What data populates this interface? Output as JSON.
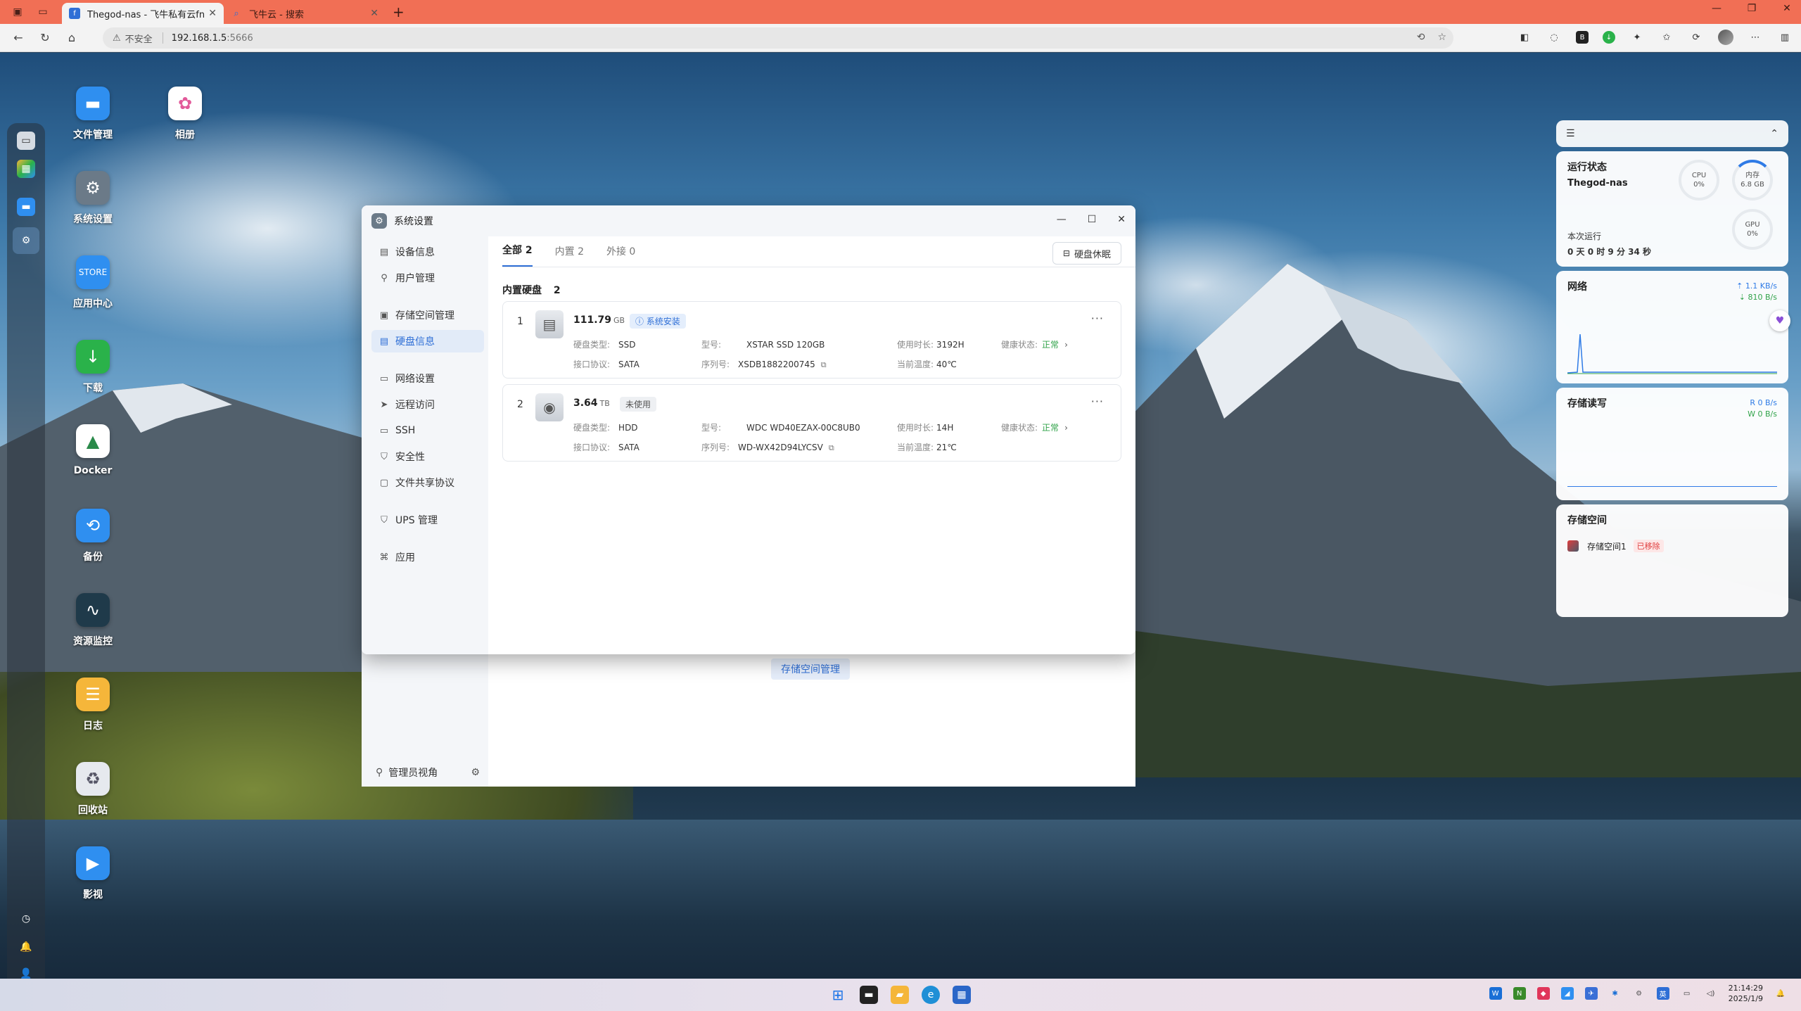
{
  "browser": {
    "tabs": [
      {
        "title": "Thegod-nas - 飞牛私有云fnOS",
        "active": true
      },
      {
        "title": "飞牛云 - 搜索",
        "active": false
      }
    ],
    "address": {
      "insecure_label": "不安全",
      "host": "192.168.1.5",
      "port": ":5666"
    }
  },
  "desktop": {
    "icons": [
      {
        "label": "文件管理",
        "icon": "folder-icon",
        "color": "#2f8ff0"
      },
      {
        "label": "相册",
        "icon": "photos-icon",
        "color": "#ffffff"
      },
      {
        "label": "系统设置",
        "icon": "gear-icon",
        "color": "#6b7a88"
      },
      {
        "label": "应用中心",
        "icon": "store-icon",
        "color": "#2f8ff0"
      },
      {
        "label": "下载",
        "icon": "download-icon",
        "color": "#2ab24a"
      },
      {
        "label": "Docker",
        "icon": "docker-icon",
        "color": "#ffffff"
      },
      {
        "label": "备份",
        "icon": "backup-icon",
        "color": "#2f8ff0"
      },
      {
        "label": "资源监控",
        "icon": "monitor-icon",
        "color": "#1f3a4a"
      },
      {
        "label": "日志",
        "icon": "log-icon",
        "color": "#f5b63a"
      },
      {
        "label": "回收站",
        "icon": "recycle-icon",
        "color": "#e6e9ee"
      },
      {
        "label": "影视",
        "icon": "video-icon",
        "color": "#2f8ff0"
      }
    ]
  },
  "widgets": {
    "status": {
      "title": "运行状态",
      "host": "Thegod-nas",
      "uptime_label": "本次运行",
      "uptime": "0 天 0 时 9 分 34 秒",
      "cpu": {
        "label": "CPU",
        "value": "0%"
      },
      "mem": {
        "label": "内存",
        "value": "6.8 GB"
      },
      "gpu": {
        "label": "GPU",
        "value": "0%"
      }
    },
    "network": {
      "title": "网络",
      "up": "1.1 KB/s",
      "down": "810 B/s"
    },
    "io": {
      "title": "存储读写",
      "read": "R  0 B/s",
      "write": "W  0 B/s"
    },
    "storage": {
      "title": "存储空间",
      "item": "存储空间1",
      "status": "已移除"
    }
  },
  "window": {
    "title": "系统设置",
    "nav": [
      {
        "label": "设备信息",
        "icon": "device-icon"
      },
      {
        "label": "用户管理",
        "icon": "user-icon"
      },
      {
        "label": "存储空间管理",
        "icon": "storage-icon"
      },
      {
        "label": "硬盘信息",
        "icon": "disk-icon",
        "selected": true
      },
      {
        "label": "网络设置",
        "icon": "network-icon"
      },
      {
        "label": "远程访问",
        "icon": "remote-icon"
      },
      {
        "label": "SSH",
        "icon": "ssh-icon"
      },
      {
        "label": "安全性",
        "icon": "shield-icon"
      },
      {
        "label": "文件共享协议",
        "icon": "share-icon"
      },
      {
        "label": "UPS 管理",
        "icon": "ups-icon"
      },
      {
        "label": "应用",
        "icon": "apps-icon"
      }
    ],
    "footer": "管理员视角",
    "tabs": [
      "全部 2",
      "内置 2",
      "外接 0"
    ],
    "sleep_button": "硬盘休眠",
    "section_title": "内置硬盘",
    "section_count": "2",
    "disks": [
      {
        "index": "1",
        "capacity": "111.79",
        "unit": "GB",
        "tag": "系统安装",
        "type_label": "硬盘类型:",
        "type": "SSD",
        "iface_label": "接口协议:",
        "iface": "SATA",
        "model_label": "型号:",
        "model": "XSTAR SSD 120GB",
        "serial_label": "序列号:",
        "serial": "XSDB1882200745",
        "hours_label": "使用时长:",
        "hours": "3192H",
        "temp_label": "当前温度:",
        "temp": "40℃",
        "health_label": "健康状态:",
        "health": "正常"
      },
      {
        "index": "2",
        "capacity": "3.64",
        "unit": "TB",
        "tag": "未使用",
        "type_label": "硬盘类型:",
        "type": "HDD",
        "iface_label": "接口协议:",
        "iface": "SATA",
        "model_label": "型号:",
        "model": "WDC WD40EZAX-00C8UB0",
        "serial_label": "序列号:",
        "serial": "WD-WX42D94LYCSV",
        "hours_label": "使用时长:",
        "hours": "14H",
        "temp_label": "当前温度:",
        "temp": "21℃",
        "health_label": "健康状态:",
        "health": "正常"
      }
    ],
    "ghost_button": "存储空间管理"
  },
  "taskbar": {
    "time": "21:14:29",
    "date": "2025/1/9"
  }
}
